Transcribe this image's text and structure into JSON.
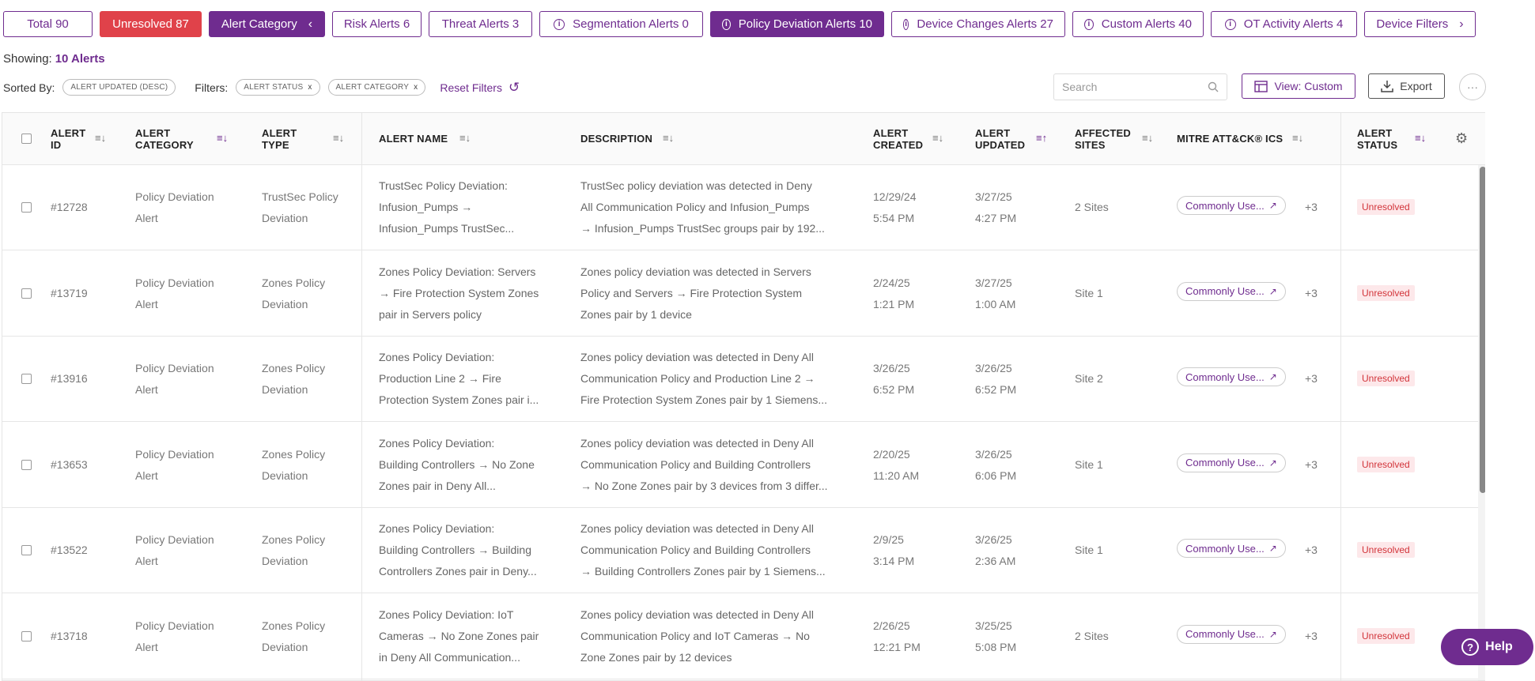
{
  "tabs": [
    {
      "label": "Total 90",
      "style": "outline"
    },
    {
      "label": "Unresolved 87",
      "style": "red"
    },
    {
      "label": "Alert Category",
      "style": "filled",
      "icon": "chevron-left-icon"
    },
    {
      "label": "Risk Alerts 6",
      "style": "outline"
    },
    {
      "label": "Threat Alerts 3",
      "style": "outline"
    },
    {
      "label": "Segmentation Alerts 0",
      "style": "outline",
      "icon": "info-icon"
    },
    {
      "label": "Policy Deviation Alerts 10",
      "style": "filled",
      "icon": "info-icon"
    },
    {
      "label": "Device Changes Alerts 27",
      "style": "outline",
      "icon": "info-icon"
    },
    {
      "label": "Custom Alerts 40",
      "style": "outline",
      "icon": "info-icon"
    },
    {
      "label": "OT Activity Alerts 4",
      "style": "outline",
      "icon": "info-icon"
    },
    {
      "label": "Device Filters",
      "style": "outline",
      "icon": "chevron-right-icon"
    }
  ],
  "showing": {
    "label": "Showing:",
    "value": "10 Alerts"
  },
  "sortbar": {
    "sorted_label": "Sorted By:",
    "sorted_chip": "ALERT UPDATED (DESC)",
    "filters_label": "Filters:",
    "filter_chips": [
      "ALERT STATUS",
      "ALERT CATEGORY"
    ],
    "reset_label": "Reset Filters"
  },
  "toolbar": {
    "search_placeholder": "Search",
    "view_label": "View: Custom",
    "export_label": "Export"
  },
  "columns": {
    "alert_id": [
      "ALERT",
      "ID"
    ],
    "alert_category": [
      "ALERT",
      "CATEGORY"
    ],
    "alert_type": [
      "ALERT",
      "TYPE"
    ],
    "alert_name": "ALERT NAME",
    "description": "DESCRIPTION",
    "alert_created": [
      "ALERT",
      "CREATED"
    ],
    "alert_updated": [
      "ALERT",
      "UPDATED"
    ],
    "affected_sites": [
      "AFFECTED",
      "SITES"
    ],
    "mitre": "MITRE ATT&CK® ICS",
    "alert_status": [
      "ALERT",
      "STATUS"
    ]
  },
  "rows": [
    {
      "id": "#12728",
      "category": [
        "Policy Deviation",
        "Alert"
      ],
      "type": [
        "TrustSec Policy",
        "Deviation"
      ],
      "name": [
        "TrustSec Policy Deviation:",
        "Infusion_Pumps → ",
        "Infusion_Pumps TrustSec..."
      ],
      "desc": [
        "TrustSec policy deviation was detected in Deny",
        "All Communication Policy and Infusion_Pumps",
        "→ Infusion_Pumps TrustSec groups pair by 192..."
      ],
      "created": [
        "12/29/24",
        "5:54 PM"
      ],
      "updated": [
        "3/27/25",
        "4:27 PM"
      ],
      "sites": "2 Sites",
      "mitre": "Commonly Use...",
      "mitre_more": "+3",
      "status": "Unresolved"
    },
    {
      "id": "#13719",
      "category": [
        "Policy Deviation",
        "Alert"
      ],
      "type": [
        "Zones Policy",
        "Deviation"
      ],
      "name": [
        "Zones Policy Deviation: Servers",
        "→ Fire Protection System Zones",
        "pair in Servers policy"
      ],
      "desc": [
        "Zones policy deviation was detected in Servers",
        "Policy and Servers → Fire Protection System",
        "Zones pair by 1 device"
      ],
      "created": [
        "2/24/25",
        "1:21 PM"
      ],
      "updated": [
        "3/27/25",
        "1:00 AM"
      ],
      "sites": "Site 1",
      "mitre": "Commonly Use...",
      "mitre_more": "+3",
      "status": "Unresolved"
    },
    {
      "id": "#13916",
      "category": [
        "Policy Deviation",
        "Alert"
      ],
      "type": [
        "Zones Policy",
        "Deviation"
      ],
      "name": [
        "Zones Policy Deviation:",
        "Production Line 2 → Fire",
        "Protection System Zones pair i..."
      ],
      "desc": [
        "Zones policy deviation was detected in Deny All",
        "Communication Policy and Production Line 2 →",
        "Fire Protection System Zones pair by 1 Siemens..."
      ],
      "created": [
        "3/26/25",
        "6:52 PM"
      ],
      "updated": [
        "3/26/25",
        "6:52 PM"
      ],
      "sites": "Site 2",
      "mitre": "Commonly Use...",
      "mitre_more": "+3",
      "status": "Unresolved"
    },
    {
      "id": "#13653",
      "category": [
        "Policy Deviation",
        "Alert"
      ],
      "type": [
        "Zones Policy",
        "Deviation"
      ],
      "name": [
        "Zones Policy Deviation:",
        "Building Controllers → No Zone",
        "Zones pair in Deny All..."
      ],
      "desc": [
        "Zones policy deviation was detected in Deny All",
        "Communication Policy and Building Controllers",
        "→ No Zone Zones pair by 3 devices from 3 differ..."
      ],
      "created": [
        "2/20/25",
        "11:20 AM"
      ],
      "updated": [
        "3/26/25",
        "6:06 PM"
      ],
      "sites": "Site 1",
      "mitre": "Commonly Use...",
      "mitre_more": "+3",
      "status": "Unresolved"
    },
    {
      "id": "#13522",
      "category": [
        "Policy Deviation",
        "Alert"
      ],
      "type": [
        "Zones Policy",
        "Deviation"
      ],
      "name": [
        "Zones Policy Deviation:",
        "Building Controllers → Building",
        "Controllers Zones pair in Deny..."
      ],
      "desc": [
        "Zones policy deviation was detected in Deny All",
        "Communication Policy and Building Controllers",
        "→ Building Controllers Zones pair by 1 Siemens..."
      ],
      "created": [
        "2/9/25",
        "3:14 PM"
      ],
      "updated": [
        "3/26/25",
        "2:36 AM"
      ],
      "sites": "Site 1",
      "mitre": "Commonly Use...",
      "mitre_more": "+3",
      "status": "Unresolved"
    },
    {
      "id": "#13718",
      "category": [
        "Policy Deviation",
        "Alert"
      ],
      "type": [
        "Zones Policy",
        "Deviation"
      ],
      "name": [
        "Zones Policy Deviation: IoT",
        "Cameras → No Zone Zones pair",
        "in Deny All Communication..."
      ],
      "desc": [
        "Zones policy deviation was detected in Deny All",
        "Communication Policy and IoT Cameras → No",
        "Zone Zones pair by 12 devices"
      ],
      "created": [
        "2/26/25",
        "12:21 PM"
      ],
      "updated": [
        "3/25/25",
        "5:08 PM"
      ],
      "sites": "2 Sites",
      "mitre": "Commonly Use...",
      "mitre_more": "+3",
      "status": "Unresolved"
    }
  ],
  "help": {
    "label": "Help"
  }
}
